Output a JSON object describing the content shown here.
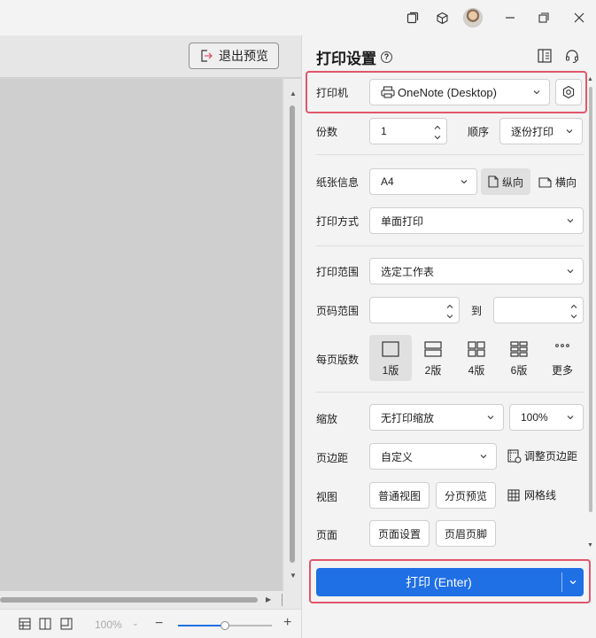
{
  "preview": {
    "exit_label": "退出预览",
    "zoom_level": "100%",
    "zoom_fraction": 0.5
  },
  "panel": {
    "title": "打印设置",
    "printer_label": "打印机",
    "printer_value": "OneNote (Desktop)",
    "copies_label": "份数",
    "copies_value": "1",
    "order_label": "顺序",
    "order_value": "逐份打印",
    "paper_label": "纸张信息",
    "paper_value": "A4",
    "portrait_label": "纵向",
    "landscape_label": "横向",
    "mode_label": "打印方式",
    "mode_value": "单面打印",
    "range_label": "打印范围",
    "range_value": "选定工作表",
    "page_range_label": "页码范围",
    "page_range_to": "到",
    "per_page_label": "每页版数",
    "layouts": [
      "1版",
      "2版",
      "4版",
      "6版",
      "更多"
    ],
    "scale_label": "缩放",
    "scale_value": "无打印缩放",
    "scale_percent": "100%",
    "margin_label": "页边距",
    "margin_value": "自定义",
    "adjust_margin_label": "调整页边距",
    "view_label": "视图",
    "normal_view_label": "普通视图",
    "page_break_label": "分页预览",
    "gridlines_label": "网格线",
    "page_label": "页面",
    "page_setup_label": "页面设置",
    "header_footer_label": "页眉页脚",
    "print_label": "打印 (Enter)"
  },
  "colors": {
    "accent": "#1f6fe5",
    "highlight": "#e0566c"
  }
}
